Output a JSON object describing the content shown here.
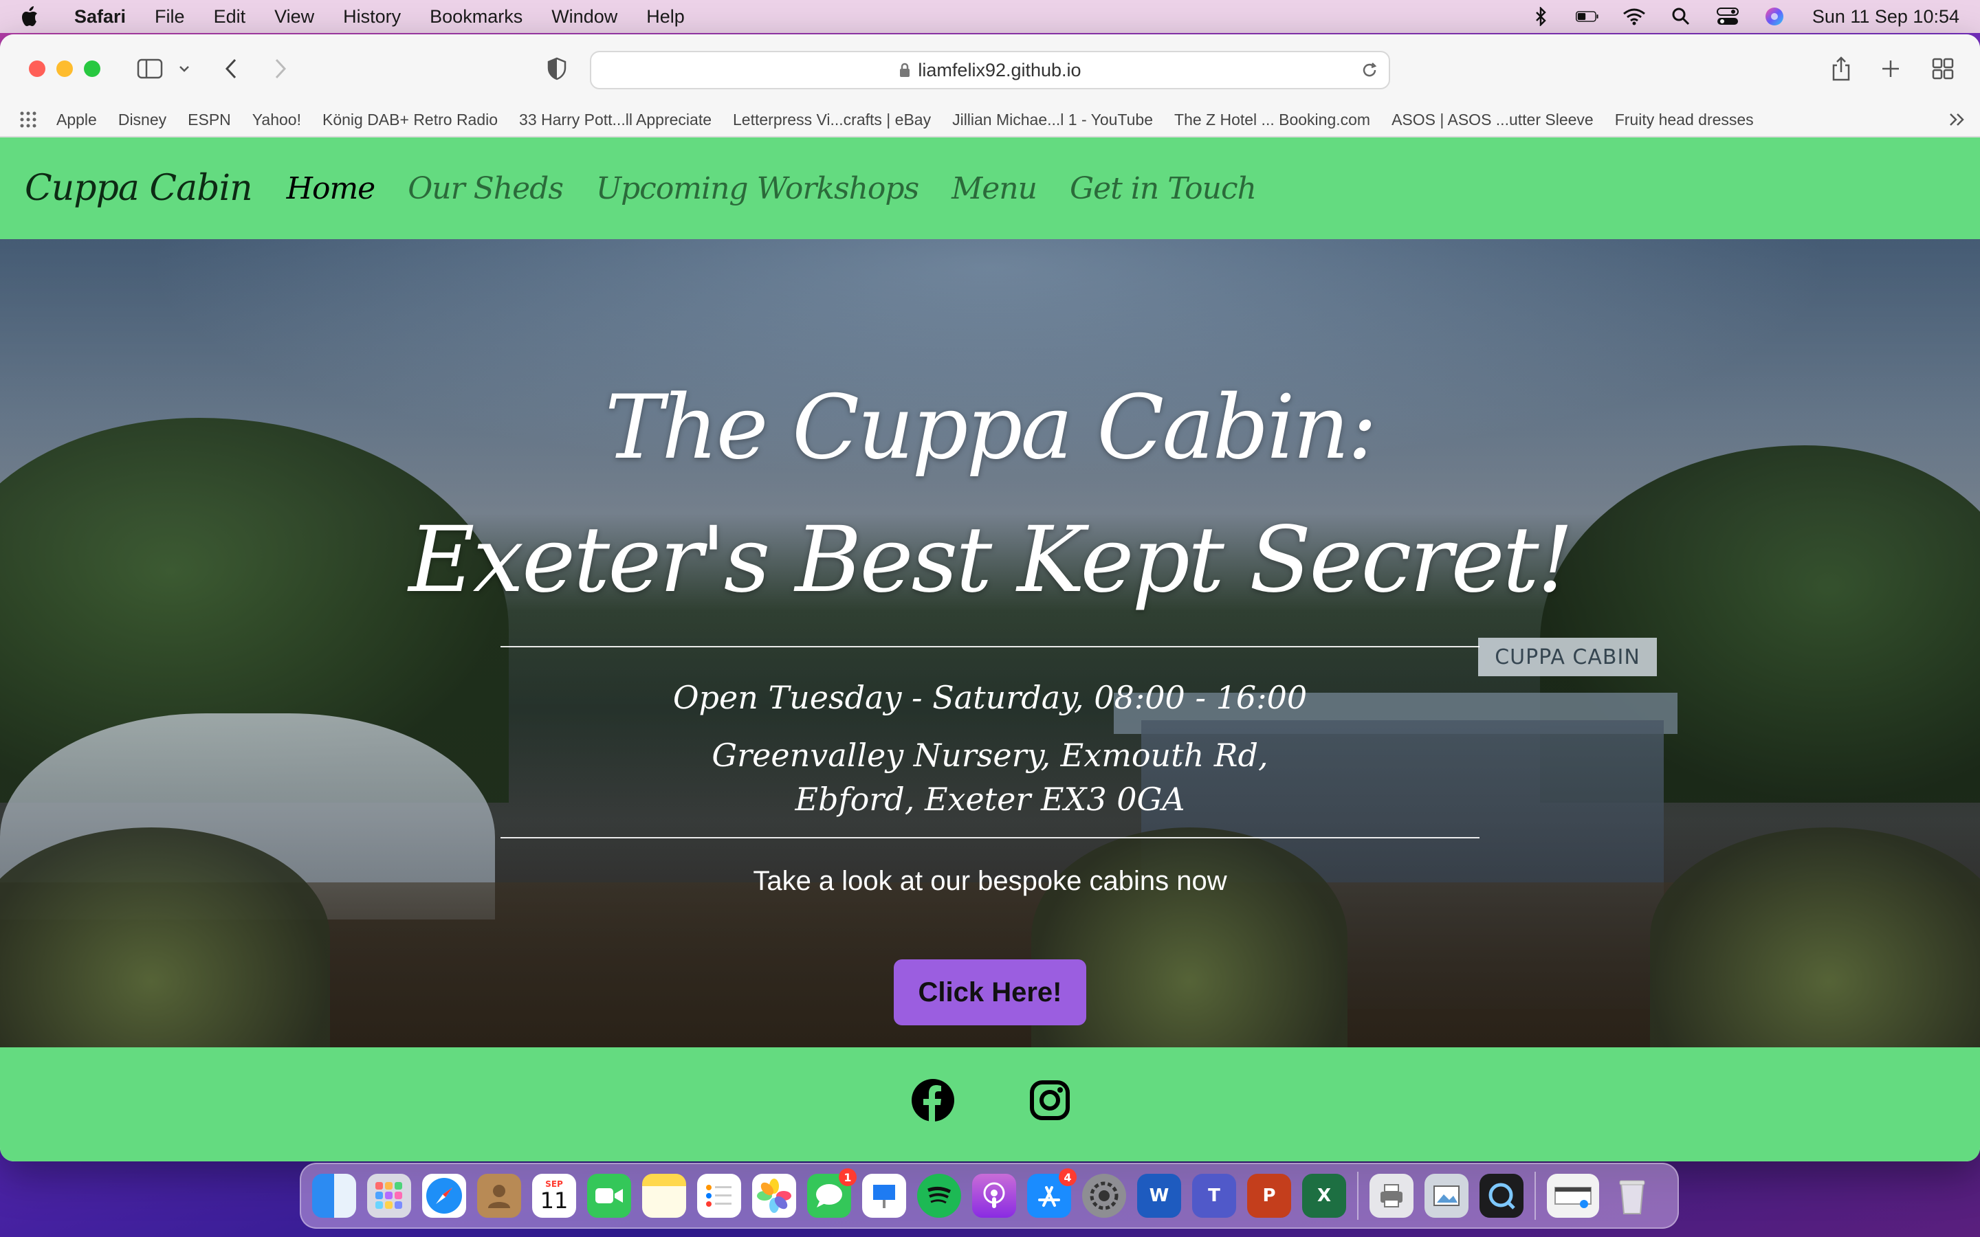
{
  "menubar": {
    "app_name": "Safari",
    "items": [
      "File",
      "Edit",
      "View",
      "History",
      "Bookmarks",
      "Window",
      "Help"
    ],
    "clock": "Sun 11 Sep  10:54"
  },
  "browser": {
    "url": "liamfelix92.github.io",
    "bookmarks": [
      "Apple",
      "Disney",
      "ESPN",
      "Yahoo!",
      "König DAB+ Retro Radio",
      "33 Harry Pott...ll Appreciate",
      "Letterpress Vi...crafts | eBay",
      "Jillian Michae...l 1 - YouTube",
      "The Z Hotel ... Booking.com",
      "ASOS | ASOS ...utter Sleeve",
      "Fruity head dresses"
    ]
  },
  "site": {
    "brand": "Cuppa Cabin",
    "nav": [
      "Home",
      "Our Sheds",
      "Upcoming Workshops",
      "Menu",
      "Get in Touch"
    ],
    "hero": {
      "title_line1": "The Cuppa Cabin:",
      "title_line2": "Exeter's Best Kept Secret!",
      "hours": "Open Tuesday - Saturday, 08:00 - 16:00",
      "address_line1": "Greenvalley Nursery, Exmouth Rd,",
      "address_line2": "Ebford, Exeter EX3 0GA",
      "tagline": "Take a look at our bespoke cabins now",
      "button": "Click Here!",
      "sign_text": "CUPPA CABIN"
    },
    "colors": {
      "nav_bg": "#64db80",
      "button_bg": "#9b5ee0"
    },
    "footer_icons": [
      "facebook-icon",
      "instagram-icon"
    ]
  },
  "dock": {
    "calendar_month": "SEP",
    "calendar_day": "11",
    "messages_badge": "1",
    "appstore_badge": "4"
  }
}
